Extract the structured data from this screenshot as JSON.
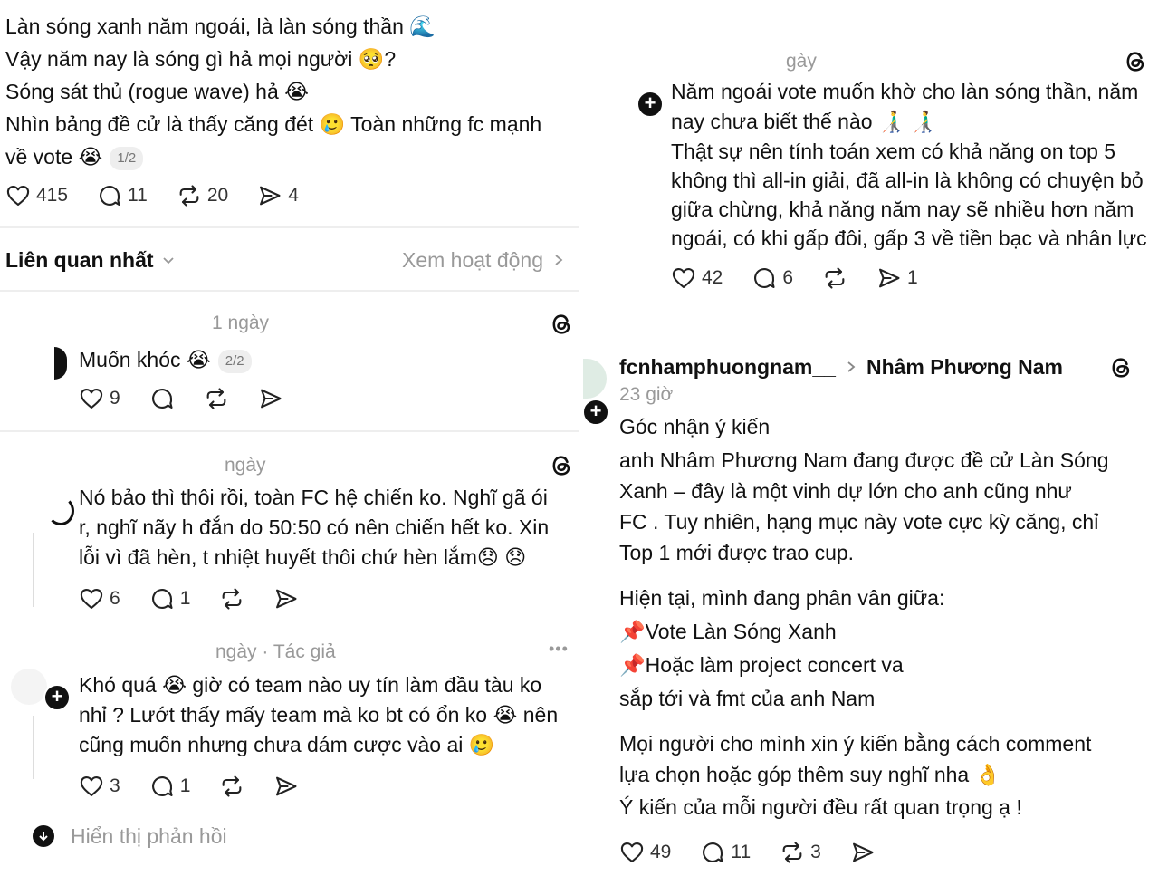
{
  "left_top": {
    "lines": [
      "Làn sóng xanh năm ngoái, là làn sóng thần 🌊",
      "Vậy năm nay là sóng gì hả mọi người 🥺?",
      "Sóng sát thủ (rogue wave) hả 😭",
      "Nhìn bảng đề cử là thấy căng đét 🥲  Toàn những fc mạnh",
      "về vote 😭"
    ],
    "page_pill": "1/2",
    "likes": "415",
    "comments": "11",
    "reposts": "20",
    "shares": "4"
  },
  "sort": {
    "label": "Liên quan nhất",
    "activity_link": "Xem hoạt động"
  },
  "reply1": {
    "time": "1 ngày",
    "text": "Muốn khóc 😭",
    "page_pill": "2/2",
    "likes": "9"
  },
  "reply2": {
    "time": "ngày",
    "lines": [
      "Nó bảo thì thôi rồi, toàn FC hệ chiến ko. Nghĩ gã ói",
      "r, nghĩ nãy h đắn do 50:50 có nên chiến hết ko. Xin",
      "lỗi vì đã hèn, t nhiệt huyết thôi chứ hèn lắm😞 😞"
    ],
    "likes": "6",
    "comments": "1"
  },
  "reply3": {
    "time": "ngày · Tác giả",
    "more": "•••",
    "lines": [
      "Khó quá 😭 giờ có team nào uy tín làm đầu tàu ko",
      "nhỉ ? Lướt thấy mấy team mà ko bt có ổn ko 😭  nên",
      "cũng muốn nhưng chưa dám cược vào ai 🥲"
    ],
    "likes": "3",
    "comments": "1"
  },
  "show_replies": "Hiển thị phản hồi",
  "right_top": {
    "time": "gày",
    "lines": [
      "Năm ngoái vote muốn khờ cho làn sóng thần, năm",
      "nay chưa biết thế nào 👨‍🦯 👨‍🦯",
      "Thật sự nên tính toán xem có khả năng on top 5",
      "không thì all-in giải, đã all-in là không có chuyện bỏ",
      "giữa chừng, khả năng năm nay sẽ nhiều hơn năm",
      "ngoái, có khi gấp đôi, gấp 3 về tiền bạc và nhân lực"
    ],
    "likes": "42",
    "comments": "6",
    "shares": "1"
  },
  "right_post": {
    "username": "fcnhamphuongnam__",
    "target": "Nhâm Phương Nam",
    "time": "23 giờ",
    "lines": [
      "Góc nhận ý kiến",
      "anh Nhâm Phương Nam đang được đề cử Làn Sóng",
      "Xanh – đây là một vinh dự  lớn cho anh cũng như",
      "FC . Tuy nhiên, hạng mục này vote cực kỳ căng, chỉ",
      "Top 1 mới được trao cup.",
      "Hiện tại, mình đang phân vân giữa:",
      "📌Vote Làn Sóng Xanh",
      "📌Hoặc làm project  concert va",
      "sắp tới và fmt của anh Nam",
      "Mọi người cho  mình xin ý kiến bằng cách comment",
      "lựa chọn hoặc góp thêm suy nghĩ nha 👌",
      "Ý kiến của mỗi người đều rất quan trọng ạ !"
    ],
    "likes": "49",
    "comments": "11",
    "reposts": "3"
  },
  "icons": [
    "heart-icon",
    "comment-icon",
    "repost-icon",
    "share-icon",
    "threads-logo-icon",
    "chevron-down-icon",
    "chevron-right-icon",
    "plus-icon",
    "arrow-down-icon"
  ]
}
